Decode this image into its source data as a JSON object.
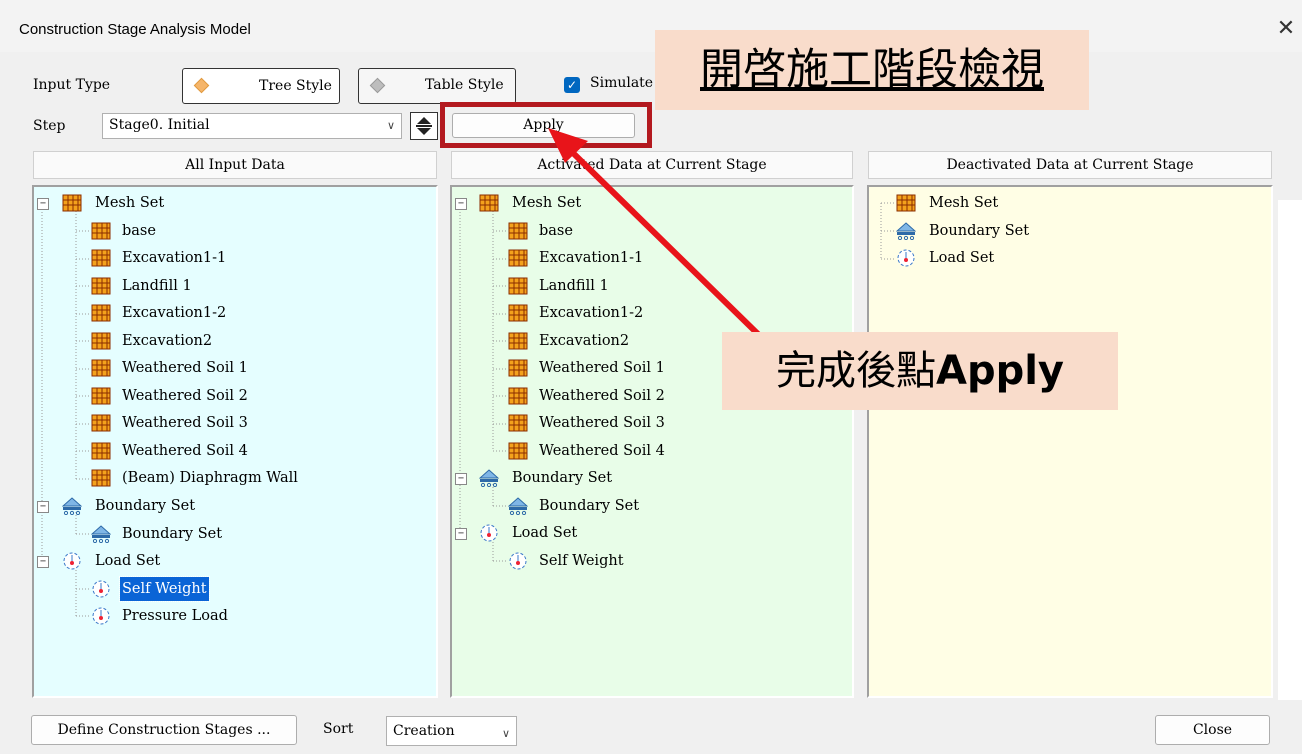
{
  "window": {
    "title": "Construction Stage Analysis Model",
    "close_glyph": "✕"
  },
  "toolbar": {
    "input_type_label": "Input Type",
    "tree_style_label": "Tree Style",
    "table_style_label": "Table Style",
    "simulate_label": "Simulate",
    "step_label": "Step",
    "step_value": "Stage0. Initial",
    "apply_label": "Apply"
  },
  "panels": {
    "all": {
      "header": "All Input Data"
    },
    "activated": {
      "header": "Activated Data at Current Stage"
    },
    "deactivated": {
      "header": "Deactivated Data at Current Stage"
    }
  },
  "tree": {
    "mesh_set": "Mesh Set",
    "mesh_items": [
      "base",
      "Excavation1-1",
      "Landfill 1",
      "Excavation1-2",
      "Excavation2",
      "Weathered Soil 1",
      "Weathered Soil 2",
      "Weathered Soil 3",
      "Weathered Soil 4",
      "(Beam) Diaphragm Wall"
    ],
    "boundary_set": "Boundary Set",
    "boundary_item": "Boundary Set",
    "load_set": "Load Set",
    "load_items": [
      "Self Weight",
      "Pressure Load"
    ]
  },
  "bottom": {
    "define_label": "Define Construction Stages ...",
    "sort_label": "Sort",
    "sort_value": "Creation",
    "close_label": "Close"
  },
  "annotations": {
    "top_note": "開啓施工階段檢視",
    "apply_note_prefix": "完成後點",
    "apply_note_bold": "Apply"
  },
  "colors": {
    "all_bg": "#e5feff",
    "activated_bg": "#e8fde8",
    "deactivated_bg": "#fffee5",
    "highlight_box": "#b3191f",
    "arrow": "#e8141a",
    "overlay_bg": "#f9dccb"
  }
}
